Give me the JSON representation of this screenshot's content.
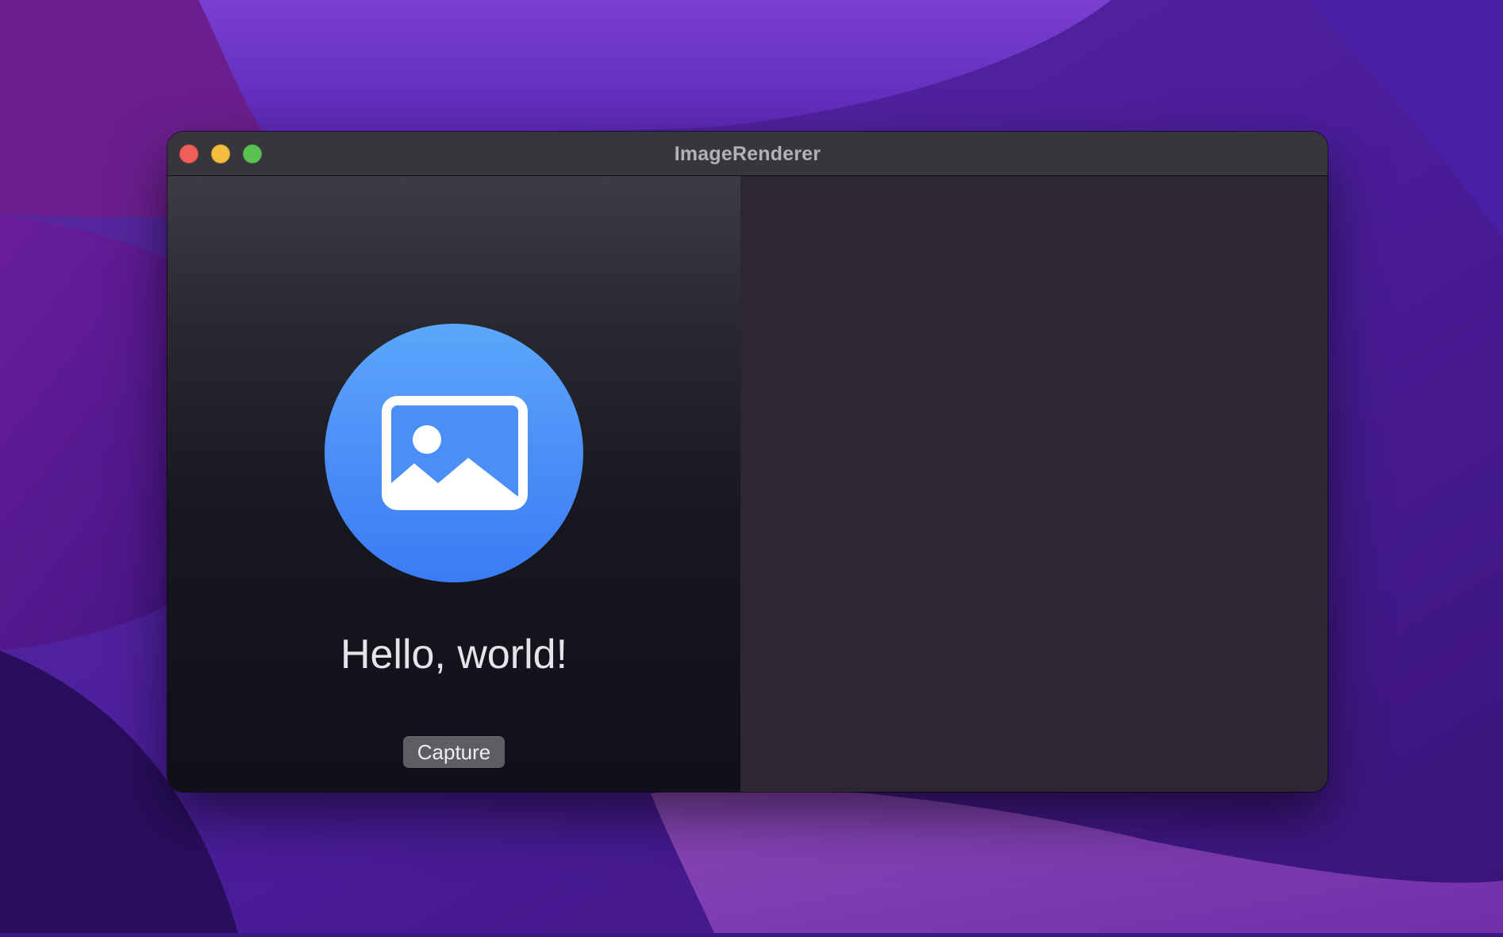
{
  "window": {
    "title": "ImageRenderer"
  },
  "traffic_lights": {
    "close_color": "#ee5f57",
    "minimize_color": "#f3be3e",
    "zoom_color": "#5ac253"
  },
  "content": {
    "icon": "photo-icon",
    "icon_background_color": "#3a7cf3",
    "greeting": "Hello, world!",
    "capture_label": "Capture"
  }
}
